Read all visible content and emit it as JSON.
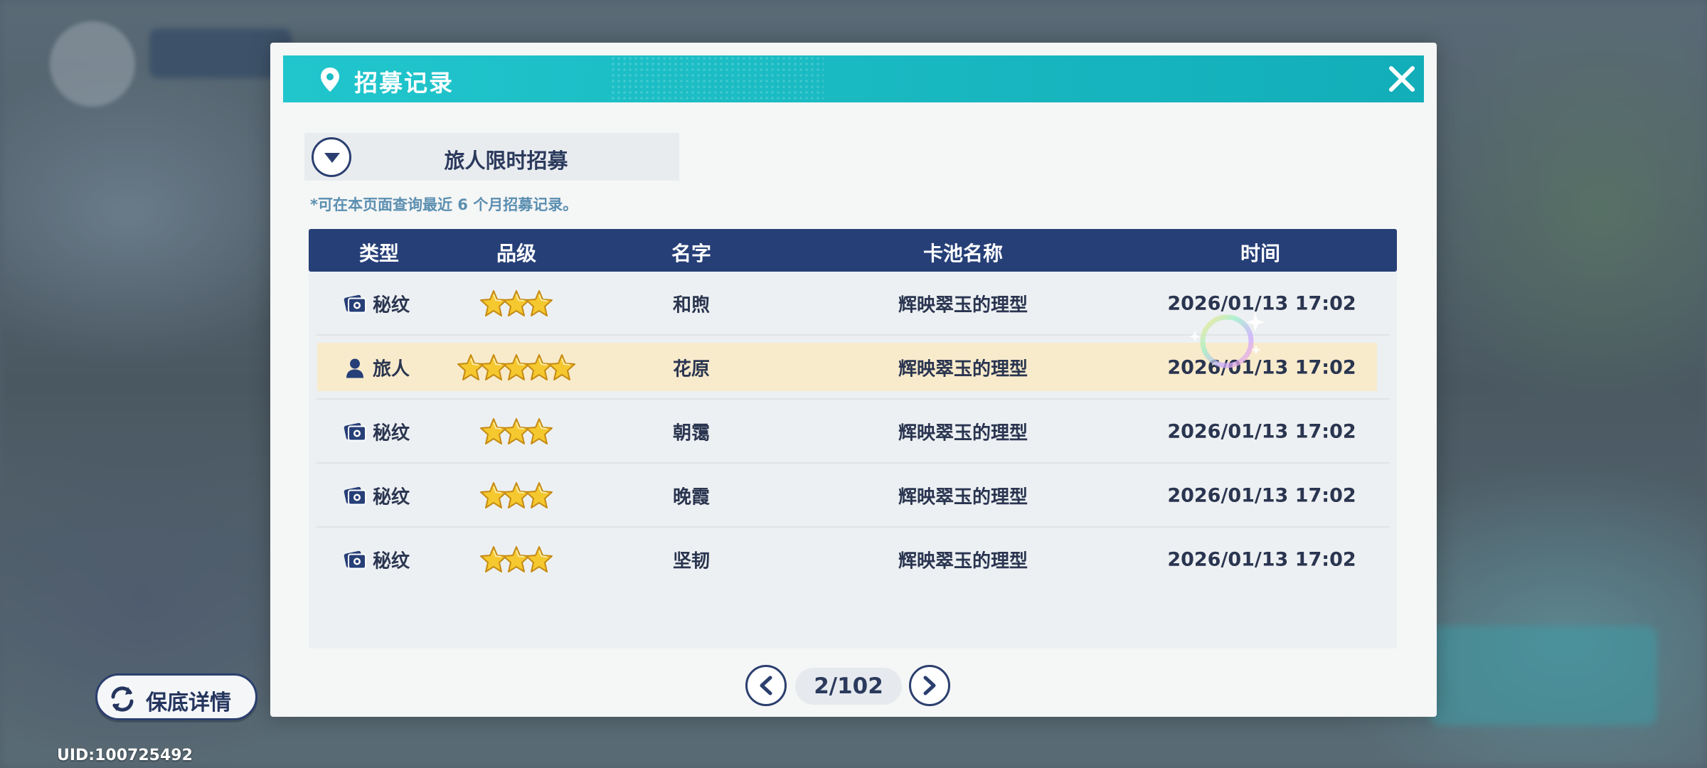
{
  "dialog": {
    "title": "招募记录",
    "pool_selector": "旅人限时招募",
    "notice": "*可在本页面查询最近 6 个月招募记录。"
  },
  "table": {
    "headers": {
      "type": "类型",
      "rarity": "品级",
      "name": "名字",
      "pool": "卡池名称",
      "time": "时间"
    },
    "rows": [
      {
        "type": "秘纹",
        "type_icon": "card-icon",
        "stars": 3,
        "name": "和煦",
        "pool": "辉映翠玉的理型",
        "time": "2026/01/13 17:02",
        "highlighted": false
      },
      {
        "type": "旅人",
        "type_icon": "person-icon",
        "stars": 5,
        "name": "花原",
        "pool": "辉映翠玉的理型",
        "time": "2026/01/13 17:02",
        "highlighted": true
      },
      {
        "type": "秘纹",
        "type_icon": "card-icon",
        "stars": 3,
        "name": "朝霭",
        "pool": "辉映翠玉的理型",
        "time": "2026/01/13 17:02",
        "highlighted": false
      },
      {
        "type": "秘纹",
        "type_icon": "card-icon",
        "stars": 3,
        "name": "晚霞",
        "pool": "辉映翠玉的理型",
        "time": "2026/01/13 17:02",
        "highlighted": false
      },
      {
        "type": "秘纹",
        "type_icon": "card-icon",
        "stars": 3,
        "name": "坚韧",
        "pool": "辉映翠玉的理型",
        "time": "2026/01/13 17:02",
        "highlighted": false
      }
    ]
  },
  "pagination": {
    "page": "2/102"
  },
  "pity_button": "保底详情",
  "uid": "UID:100725492",
  "colors": {
    "header_teal": "#1bbcc4",
    "table_head_navy": "#263f77",
    "highlight_row": "#f8ebcc",
    "star_gold": "#f5c830"
  }
}
